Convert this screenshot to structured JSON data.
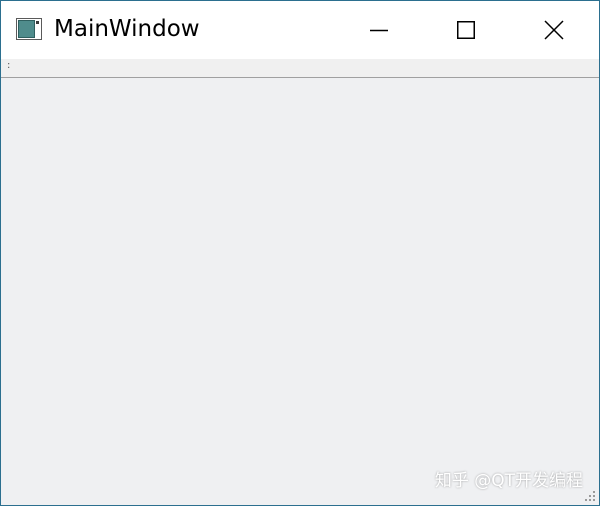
{
  "window": {
    "title": "MainWindow",
    "app_icon": "qt-window-icon",
    "controls": {
      "minimize_icon": "minimize-icon",
      "maximize_icon": "maximize-icon",
      "close_icon": "close-icon"
    }
  },
  "toolbar": {
    "grip_text": ":"
  },
  "watermark": {
    "text": "知乎 @QT开发编程"
  },
  "colors": {
    "border": "#2b6f8f",
    "titlebar": "#ffffff",
    "central": "#eff0f2",
    "separator": "#a0a0a0"
  }
}
